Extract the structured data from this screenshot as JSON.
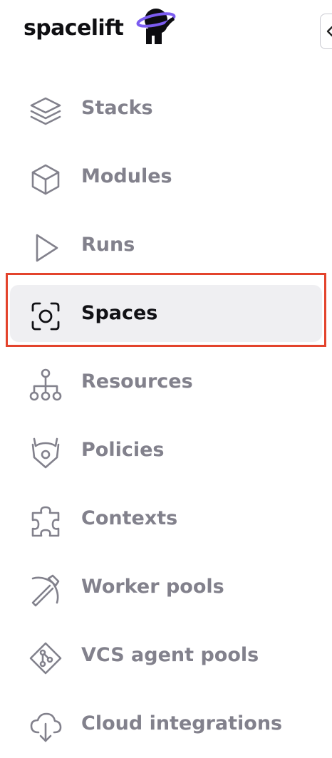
{
  "brand": {
    "name": "spacelift",
    "mascot_icon": "astronaut-mascot-icon"
  },
  "collapse_button": {
    "icon": "chevron-left-icon"
  },
  "nav": {
    "items": [
      {
        "label": "Stacks",
        "icon": "layers-icon",
        "active": false
      },
      {
        "label": "Modules",
        "icon": "cube-icon",
        "active": false
      },
      {
        "label": "Runs",
        "icon": "play-icon",
        "active": false
      },
      {
        "label": "Spaces",
        "icon": "focus-circle-icon",
        "active": true
      },
      {
        "label": "Resources",
        "icon": "hierarchy-icon",
        "active": false
      },
      {
        "label": "Policies",
        "icon": "shield-horns-icon",
        "active": false
      },
      {
        "label": "Contexts",
        "icon": "puzzle-icon",
        "active": false
      },
      {
        "label": "Worker pools",
        "icon": "pickaxe-icon",
        "active": false
      },
      {
        "label": "VCS agent pools",
        "icon": "git-branch-diamond-icon",
        "active": false
      },
      {
        "label": "Cloud integrations",
        "icon": "cloud-download-icon",
        "active": false
      }
    ]
  },
  "colors": {
    "active_background": "#efeff2",
    "inactive_text": "#82818c",
    "active_text": "#111115",
    "highlight_border": "#e3432c",
    "mascot_ring": "#7b5cf0"
  }
}
